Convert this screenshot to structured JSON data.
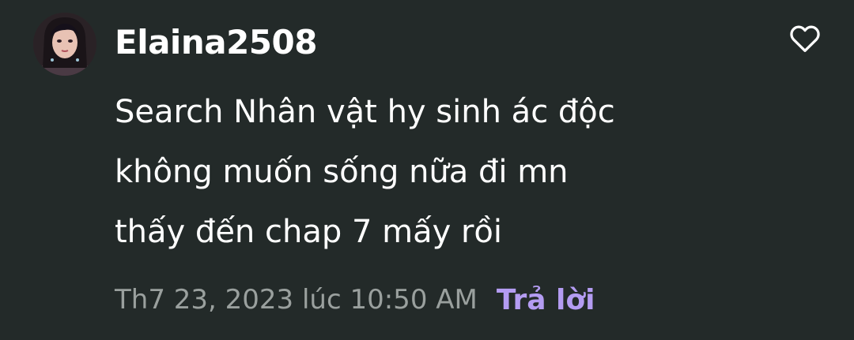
{
  "comment": {
    "username": "Elaina2508",
    "avatar_icon": "user-avatar-portrait",
    "like_icon": "heart-outline-icon",
    "body_lines": [
      "Search Nhân vật hy sinh ác độc",
      "không muốn sống nữa đi mn",
      "thấy đến chap 7 mấy rồi"
    ],
    "timestamp": "Th7 23, 2023 lúc 10:50 AM",
    "reply_label": "Trả lời"
  },
  "colors": {
    "background": "#232a29",
    "text": "#ffffff",
    "muted": "#9aa09e",
    "accent": "#b49cf2"
  }
}
